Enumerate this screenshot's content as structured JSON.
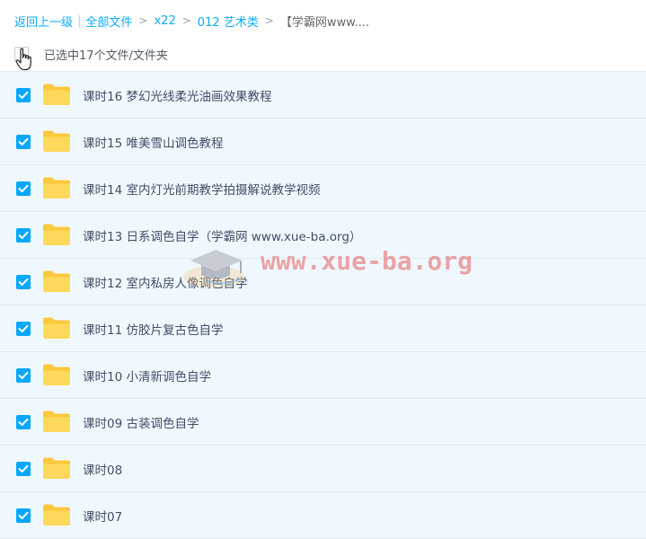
{
  "breadcrumb": {
    "back": "返回上一级",
    "all_files": "全部文件",
    "sep": ">",
    "bar": "|",
    "level1": "x22",
    "level2": "012 艺术类",
    "current": "【学霸网www...."
  },
  "selection": {
    "summary": "已选中17个文件/文件夹"
  },
  "files": [
    {
      "name": "课时16 梦幻光线柔光油画效果教程",
      "checked": true
    },
    {
      "name": "课时15 唯美雪山调色教程",
      "checked": true
    },
    {
      "name": "课时14 室内灯光前期教学拍摄解说教学视频",
      "checked": true
    },
    {
      "name": "课时13 日系调色自学（学霸网 www.xue-ba.org）",
      "checked": true
    },
    {
      "name": "课时12 室内私房人像调色自学",
      "checked": true
    },
    {
      "name": "课时11 仿胶片复古色自学",
      "checked": true
    },
    {
      "name": "课时10 小清新调色自学",
      "checked": true
    },
    {
      "name": "课时09 古装调色自学",
      "checked": true
    },
    {
      "name": "课时08",
      "checked": true
    },
    {
      "name": "课时07",
      "checked": true
    }
  ],
  "watermark": {
    "text": "www.xue-ba.org",
    "color": "#e85c5c"
  },
  "colors": {
    "accent": "#06a7ff",
    "link": "#09aaff",
    "row_bg": "#f0f8ff",
    "folder": "#ffd24d"
  },
  "icons": {
    "checkbox": "checkmark-icon",
    "folder": "folder-icon",
    "cursor": "hand-pointer-icon"
  }
}
